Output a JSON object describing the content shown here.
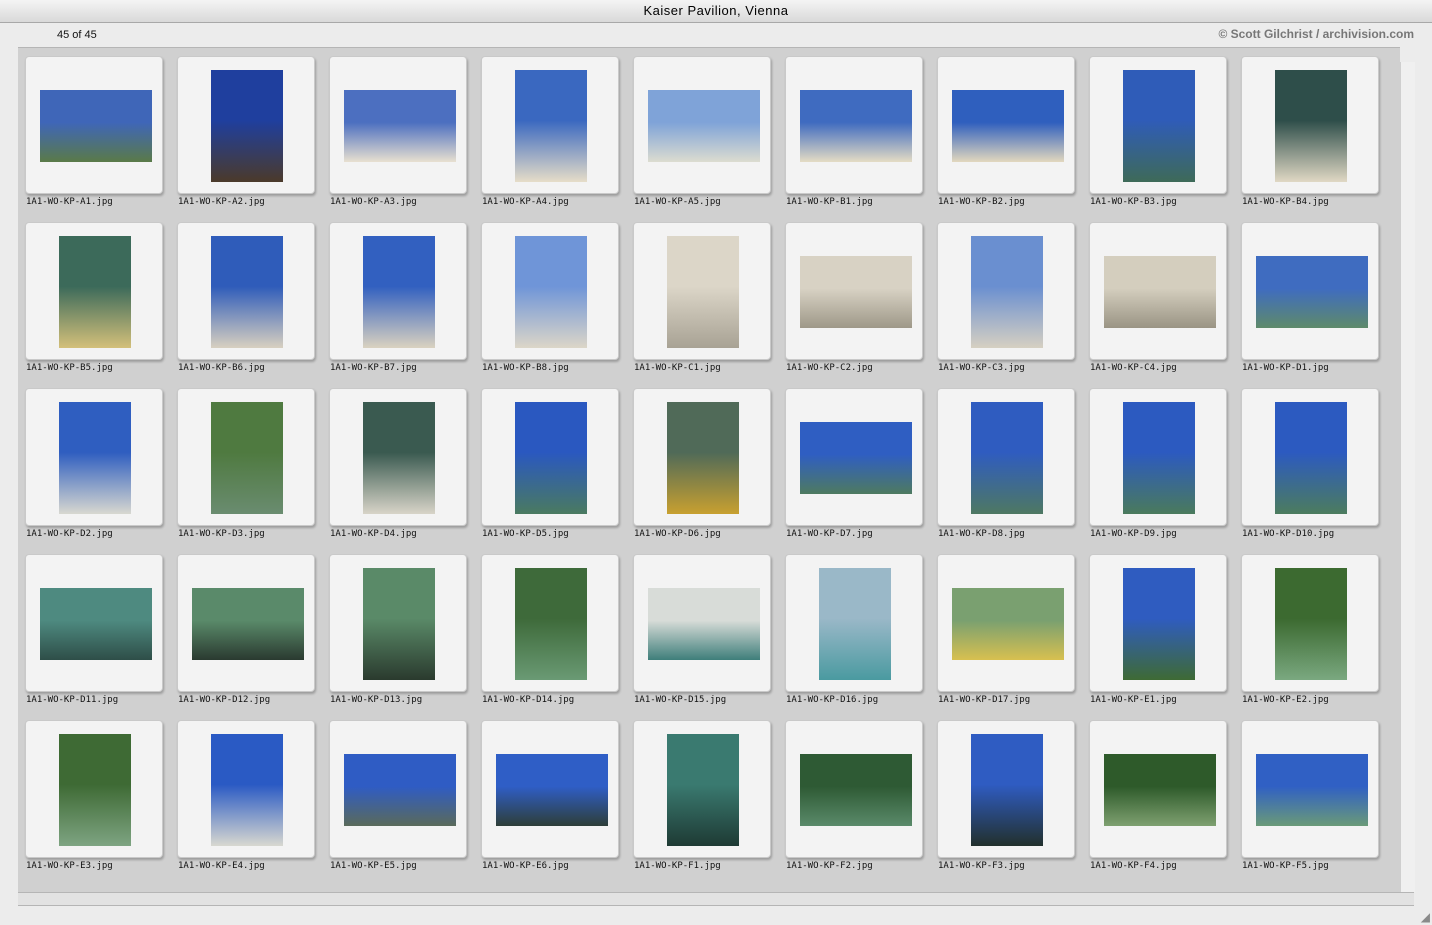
{
  "window": {
    "title": "Kaiser Pavilion, Vienna"
  },
  "status": {
    "count": "45 of 45",
    "copyright": "© Scott Gilchrist / archivision.com"
  },
  "items": [
    {
      "file": "1A1-WO-KP-A1.jpg",
      "orient": "land",
      "c1": "#3f66b8",
      "c2": "#5a7a48"
    },
    {
      "file": "1A1-WO-KP-A2.jpg",
      "orient": "port",
      "c1": "#1f3f9e",
      "c2": "#4b3a2a"
    },
    {
      "file": "1A1-WO-KP-A3.jpg",
      "orient": "land",
      "c1": "#4c6fc0",
      "c2": "#e8e0d0"
    },
    {
      "file": "1A1-WO-KP-A4.jpg",
      "orient": "port",
      "c1": "#3a68c0",
      "c2": "#e6ddc8"
    },
    {
      "file": "1A1-WO-KP-A5.jpg",
      "orient": "land",
      "c1": "#7fa3d8",
      "c2": "#dcdcd0"
    },
    {
      "file": "1A1-WO-KP-B1.jpg",
      "orient": "land",
      "c1": "#3f6bc0",
      "c2": "#e4dcc4"
    },
    {
      "file": "1A1-WO-KP-B2.jpg",
      "orient": "land",
      "c1": "#2f5fbe",
      "c2": "#e2d8be"
    },
    {
      "file": "1A1-WO-KP-B3.jpg",
      "orient": "port",
      "c1": "#2f5cb8",
      "c2": "#3e6a58"
    },
    {
      "file": "1A1-WO-KP-B4.jpg",
      "orient": "port",
      "c1": "#2e4e4a",
      "c2": "#e0d8c4"
    },
    {
      "file": "1A1-WO-KP-B5.jpg",
      "orient": "port",
      "c1": "#3c6a5a",
      "c2": "#d4c07a"
    },
    {
      "file": "1A1-WO-KP-B6.jpg",
      "orient": "port",
      "c1": "#2f5cba",
      "c2": "#d8d0c0"
    },
    {
      "file": "1A1-WO-KP-B7.jpg",
      "orient": "port",
      "c1": "#3260c0",
      "c2": "#dad2c0"
    },
    {
      "file": "1A1-WO-KP-B8.jpg",
      "orient": "port",
      "c1": "#6f95d8",
      "c2": "#dcd6c8"
    },
    {
      "file": "1A1-WO-KP-C1.jpg",
      "orient": "port",
      "c1": "#dcd6c8",
      "c2": "#a8a294"
    },
    {
      "file": "1A1-WO-KP-C2.jpg",
      "orient": "land",
      "c1": "#d8d2c4",
      "c2": "#9e9888"
    },
    {
      "file": "1A1-WO-KP-C3.jpg",
      "orient": "port",
      "c1": "#6a8fd0",
      "c2": "#d6d0c2"
    },
    {
      "file": "1A1-WO-KP-C4.jpg",
      "orient": "land",
      "c1": "#d4cebe",
      "c2": "#9a9484"
    },
    {
      "file": "1A1-WO-KP-D1.jpg",
      "orient": "land",
      "c1": "#3f6cc0",
      "c2": "#5e8a6a"
    },
    {
      "file": "1A1-WO-KP-D2.jpg",
      "orient": "port",
      "c1": "#2f5ec0",
      "c2": "#d8d8d0"
    },
    {
      "file": "1A1-WO-KP-D3.jpg",
      "orient": "port",
      "c1": "#4f7a40",
      "c2": "#6a8c70"
    },
    {
      "file": "1A1-WO-KP-D4.jpg",
      "orient": "port",
      "c1": "#3a5a50",
      "c2": "#d8d4c8"
    },
    {
      "file": "1A1-WO-KP-D5.jpg",
      "orient": "port",
      "c1": "#2a58c0",
      "c2": "#4a7a60"
    },
    {
      "file": "1A1-WO-KP-D6.jpg",
      "orient": "port",
      "c1": "#506a58",
      "c2": "#c8a030"
    },
    {
      "file": "1A1-WO-KP-D7.jpg",
      "orient": "land",
      "c1": "#2f5ec2",
      "c2": "#4e7a60"
    },
    {
      "file": "1A1-WO-KP-D8.jpg",
      "orient": "port",
      "c1": "#2f5cc0",
      "c2": "#4e7862"
    },
    {
      "file": "1A1-WO-KP-D9.jpg",
      "orient": "port",
      "c1": "#2c5ac0",
      "c2": "#4a7a5c"
    },
    {
      "file": "1A1-WO-KP-D10.jpg",
      "orient": "port",
      "c1": "#2c5ac0",
      "c2": "#4c7c5e"
    },
    {
      "file": "1A1-WO-KP-D11.jpg",
      "orient": "land",
      "c1": "#4e8a80",
      "c2": "#2e4e48"
    },
    {
      "file": "1A1-WO-KP-D12.jpg",
      "orient": "land",
      "c1": "#5a8a6a",
      "c2": "#2a3a30"
    },
    {
      "file": "1A1-WO-KP-D13.jpg",
      "orient": "port",
      "c1": "#5a8a68",
      "c2": "#2a3a2e"
    },
    {
      "file": "1A1-WO-KP-D14.jpg",
      "orient": "port",
      "c1": "#3e6a3a",
      "c2": "#6a9a74"
    },
    {
      "file": "1A1-WO-KP-D15.jpg",
      "orient": "land",
      "c1": "#d8dcd8",
      "c2": "#3e7e7a"
    },
    {
      "file": "1A1-WO-KP-D16.jpg",
      "orient": "port",
      "c1": "#9ab8c8",
      "c2": "#4a9aa0"
    },
    {
      "file": "1A1-WO-KP-D17.jpg",
      "orient": "land",
      "c1": "#7aa070",
      "c2": "#d8c050"
    },
    {
      "file": "1A1-WO-KP-E1.jpg",
      "orient": "port",
      "c1": "#2f5cc0",
      "c2": "#3e6a34"
    },
    {
      "file": "1A1-WO-KP-E2.jpg",
      "orient": "port",
      "c1": "#3c6a30",
      "c2": "#7aa880"
    },
    {
      "file": "1A1-WO-KP-E3.jpg",
      "orient": "port",
      "c1": "#3e6a34",
      "c2": "#7ea482"
    },
    {
      "file": "1A1-WO-KP-E4.jpg",
      "orient": "port",
      "c1": "#2a5ac4",
      "c2": "#d8d8d0"
    },
    {
      "file": "1A1-WO-KP-E5.jpg",
      "orient": "land",
      "c1": "#2f5cc4",
      "c2": "#5a6a5a"
    },
    {
      "file": "1A1-WO-KP-E6.jpg",
      "orient": "land",
      "c1": "#2f5ec6",
      "c2": "#2e3e38"
    },
    {
      "file": "1A1-WO-KP-F1.jpg",
      "orient": "port",
      "c1": "#3a7a70",
      "c2": "#1e3a34"
    },
    {
      "file": "1A1-WO-KP-F2.jpg",
      "orient": "land",
      "c1": "#2e5a34",
      "c2": "#5a8a6a"
    },
    {
      "file": "1A1-WO-KP-F3.jpg",
      "orient": "port",
      "c1": "#2f5cc2",
      "c2": "#22302c"
    },
    {
      "file": "1A1-WO-KP-F4.jpg",
      "orient": "land",
      "c1": "#2e5a2a",
      "c2": "#7ea070"
    },
    {
      "file": "1A1-WO-KP-F5.jpg",
      "orient": "land",
      "c1": "#3060c4",
      "c2": "#6a9a78"
    }
  ]
}
